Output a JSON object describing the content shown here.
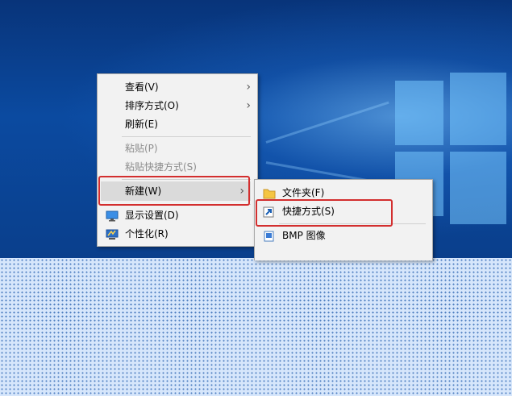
{
  "context_menu": {
    "items": [
      {
        "label": "查看(V)"
      },
      {
        "label": "排序方式(O)"
      },
      {
        "label": "刷新(E)"
      },
      {
        "label": "粘贴(P)"
      },
      {
        "label": "粘贴快捷方式(S)"
      },
      {
        "label": "新建(W)"
      },
      {
        "label": "显示设置(D)"
      },
      {
        "label": "个性化(R)"
      }
    ]
  },
  "submenu": {
    "items": [
      {
        "label": "文件夹(F)"
      },
      {
        "label": "快捷方式(S)"
      },
      {
        "label": "BMP 图像"
      }
    ]
  },
  "arrow_glyph": "›",
  "colors": {
    "highlight": "#d32f2f",
    "menu_bg": "#f2f2f2",
    "hover": "#dadada"
  }
}
